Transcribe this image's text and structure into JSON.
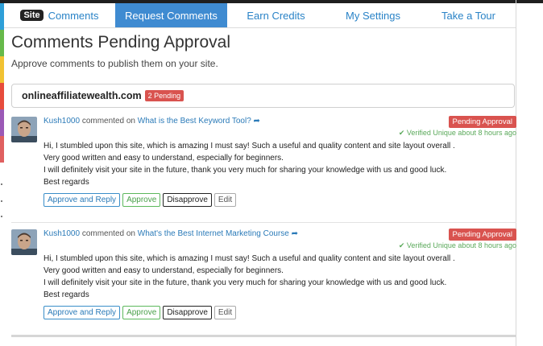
{
  "colors": {
    "accent": "#3f8bd1",
    "link": "#2a7ab8",
    "danger": "#d9534f",
    "success": "#5cb85c",
    "left_bar": [
      "#2e9fd8",
      "#66b94a",
      "#f1c232",
      "#e74c3c",
      "#9b59b6",
      "#e06060"
    ]
  },
  "nav": {
    "brand_badge": "Site",
    "brand_label": "Comments",
    "tabs": [
      {
        "label": "Request Comments",
        "active": true
      },
      {
        "label": "Earn Credits",
        "active": false
      },
      {
        "label": "My Settings",
        "active": false
      },
      {
        "label": "Take a Tour",
        "active": false
      }
    ]
  },
  "page": {
    "title": "Comments Pending Approval",
    "subtitle": "Approve comments to publish them on your site."
  },
  "site": {
    "domain": "onlineaffiliatewealth.com",
    "pending_badge": "2 Pending"
  },
  "comments": [
    {
      "author": "Kush1000",
      "commented_on": "commented on",
      "post_title": "What is the Best Keyword Tool?",
      "status": "Pending Approval",
      "verified": "Verified Unique about 8 hours ago",
      "lines": [
        "Hi, I stumbled upon this site, which is amazing I must say! Such a useful and quality content and site layout overall .",
        "Very good written and easy to understand, especially for beginners.",
        "I will definitely visit your site in the future, thank you very much for sharing your knowledge with us and good luck.",
        "Best regards"
      ],
      "actions": {
        "approve_reply": "Approve and Reply",
        "approve": "Approve",
        "disapprove": "Disapprove",
        "edit": "Edit"
      }
    },
    {
      "author": "Kush1000",
      "commented_on": "commented on",
      "post_title": "What's the Best Internet Marketing Course",
      "status": "Pending Approval",
      "verified": "Verified Unique about 8 hours ago",
      "lines": [
        "Hi, I stumbled upon this site, which is amazing I must say! Such a useful and quality content and site layout overall .",
        "Very good written and easy to understand, especially for beginners.",
        "I will definitely visit your site in the future, thank you very much for sharing your knowledge with us and good luck.",
        "Best regards"
      ],
      "actions": {
        "approve_reply": "Approve and Reply",
        "approve": "Approve",
        "disapprove": "Disapprove",
        "edit": "Edit"
      }
    }
  ]
}
